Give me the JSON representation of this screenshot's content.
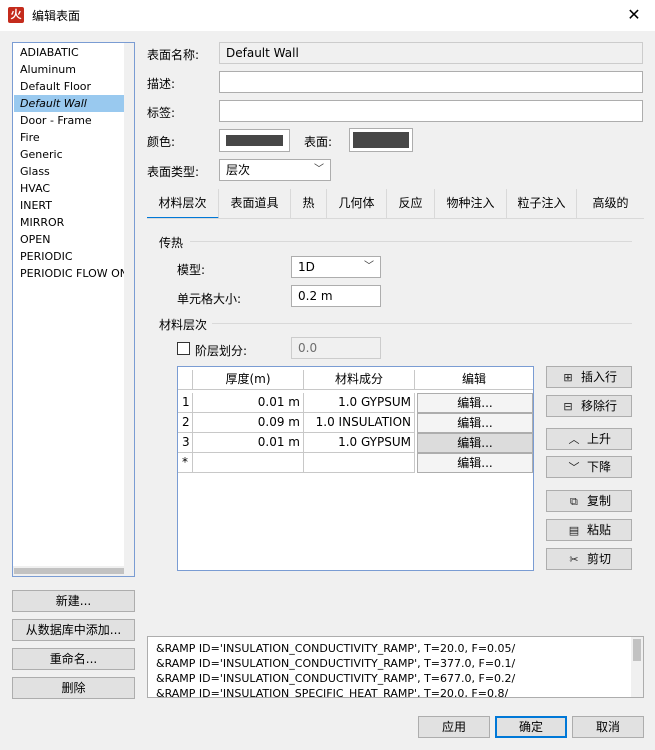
{
  "window": {
    "title": "编辑表面",
    "app_icon_glyph": "火"
  },
  "surface_list": {
    "items": [
      "ADIABATIC",
      "Aluminum",
      "Default Floor",
      "Default Wall",
      "Door - Frame",
      "Fire",
      "Generic",
      "Glass",
      "HVAC",
      "INERT",
      "MIRROR",
      "OPEN",
      "PERIODIC",
      "PERIODIC FLOW ONLY"
    ],
    "selected": "Default Wall"
  },
  "left_buttons": {
    "new": "新建...",
    "add_from_db": "从数据库中添加...",
    "rename": "重命名...",
    "delete": "删除"
  },
  "form": {
    "name_label": "表面名称:",
    "name_value": "Default Wall",
    "desc_label": "描述:",
    "desc_value": "",
    "tag_label": "标签:",
    "tag_value": "",
    "color_label": "颜色:",
    "surface_label": "表面:",
    "color_value": "#474747",
    "surface_color_value": "#474747",
    "type_label": "表面类型:",
    "type_value": "层次"
  },
  "tabs": [
    "材料层次",
    "表面道具",
    "热",
    "几何体",
    "反应",
    "物种注入",
    "粒子注入",
    "高级的"
  ],
  "active_tab": "材料层次",
  "heat_transfer": {
    "group_title": "传热",
    "model_label": "模型:",
    "model_value": "1D",
    "cell_size_label": "单元格大小:",
    "cell_size_value": "0.2 m"
  },
  "material_layers": {
    "group_title": "材料层次",
    "layer_split_label": "阶层划分:",
    "layer_split_value": "0.0",
    "layer_split_checked": false,
    "columns": [
      "厚度(m)",
      "材料成分",
      "编辑"
    ],
    "rows": [
      {
        "index": "1",
        "thickness": "0.01 m",
        "material": "1.0 GYPSUM",
        "edit": "编辑..."
      },
      {
        "index": "2",
        "thickness": "0.09 m",
        "material": "1.0 INSULATION",
        "edit": "编辑..."
      },
      {
        "index": "3",
        "thickness": "0.01 m",
        "material": "1.0 GYPSUM",
        "edit": "编辑..."
      },
      {
        "index": "*",
        "thickness": "",
        "material": "",
        "edit": "编辑..."
      }
    ],
    "side_buttons": {
      "insert_row": "插入行",
      "remove_row": "移除行",
      "move_up": "上升",
      "move_down": "下降",
      "copy": "复制",
      "paste": "粘贴",
      "cut": "剪切"
    }
  },
  "output_lines": [
    "&RAMP ID='INSULATION_CONDUCTIVITY_RAMP', T=20.0, F=0.05/",
    "&RAMP ID='INSULATION_CONDUCTIVITY_RAMP', T=377.0, F=0.1/",
    "&RAMP ID='INSULATION_CONDUCTIVITY_RAMP', T=677.0, F=0.2/",
    "&RAMP ID='INSULATION_SPECIFIC_HEAT_RAMP', T=20.0, F=0.8/"
  ],
  "footer": {
    "apply": "应用",
    "ok": "确定",
    "cancel": "取消"
  }
}
